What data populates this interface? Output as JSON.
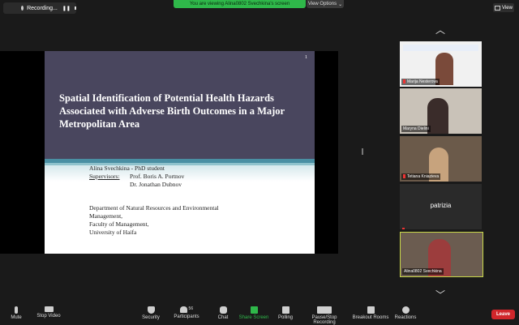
{
  "top": {
    "recording_label": "Recording...",
    "share_banner": "You are viewing Alina0802 Svechkina's screen",
    "view_options": "View Options",
    "view_button": "View"
  },
  "slide": {
    "number": "1",
    "title": "Spatial Identification of Potential Health Hazards Associated with Adverse Birth Outcomes in a Major Metropolitan Area",
    "author": "Alina Svechkina  - PhD  student",
    "supervisors_label": "Supervisors",
    "supervisor1": "Prof. Boris A. Portnov",
    "supervisor2": "Dr.  Jonathan Dubnov",
    "dept_line1": "Department of Natural Resources and Environmental",
    "dept_line2": "Management,",
    "dept_line3": "Faculty of Management,",
    "dept_line4": "University of Haifa"
  },
  "participants": [
    {
      "name": "Marija Nesterova",
      "muted": true
    },
    {
      "name": "Maryna Dielini",
      "muted": false
    },
    {
      "name": "Tetiana Kniazieva",
      "muted": true
    },
    {
      "name": "patrizia",
      "muted": true
    },
    {
      "name": "Alina0802 Svechkina",
      "muted": false
    }
  ],
  "toolbar": {
    "mute": "Mute",
    "stop_video": "Stop Video",
    "security": "Security",
    "participants": "Participants",
    "participants_count": "56",
    "chat": "Chat",
    "share_screen": "Share Screen",
    "polling": "Polling",
    "pause_recording": "Pause/Stop Recording",
    "breakout": "Breakout Rooms",
    "reactions": "Reactions",
    "leave": "Leave"
  },
  "colors": {
    "share_green": "#2fb84a",
    "leave_red": "#d1262b",
    "slide_header": "#49465e",
    "active_speaker_border": "#c8d84a"
  }
}
